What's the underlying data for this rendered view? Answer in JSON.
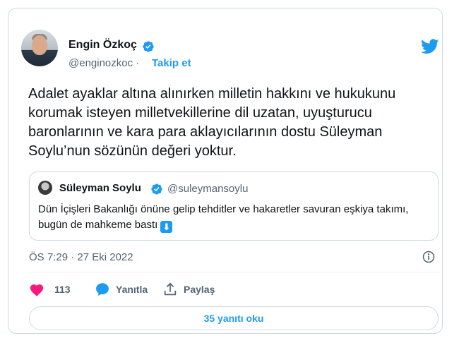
{
  "author": {
    "name": "Engin Özkoç",
    "handle": "@enginozkoc",
    "separator": "·",
    "follow_label": "Takip et"
  },
  "tweet": {
    "text": "Adalet ayaklar altına alınırken milletin hakkını ve hukukunu korumak isteyen milletvekillerine dil uzatan, uyuşturucu baronlarının ve kara para aklayıcılarının dostu Süleyman Soylu’nun sözünün değeri yoktur.",
    "timestamp": "ÖS 7:29 · 27 Eki 2022"
  },
  "quoted": {
    "name": "Süleyman Soylu",
    "handle": "@suleymansoylu",
    "text": "Dün İçişleri Bakanlığı önüne gelip tehditler ve hakaretler savuran eşkiya takımı, bugün de mahkeme bastı",
    "emoji": "⬇"
  },
  "actions": {
    "like_count": "113",
    "reply_label": "Yanıtla",
    "share_label": "Paylaş"
  },
  "replies_button": "35 yanıtı oku",
  "icons": [
    "verified-badge-icon",
    "twitter-bird-icon",
    "info-icon",
    "heart-icon",
    "reply-bubble-icon",
    "share-icon"
  ],
  "colors": {
    "accent": "#1d9bf0",
    "like": "#f91880",
    "muted": "#536471"
  }
}
